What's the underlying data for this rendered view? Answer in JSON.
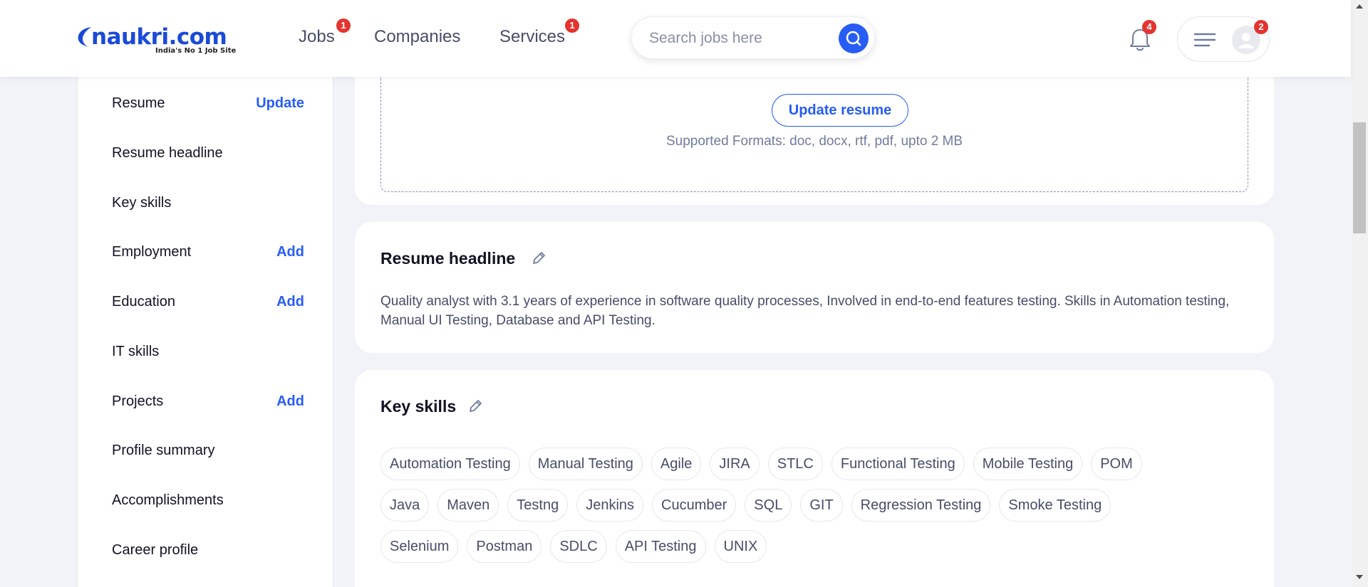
{
  "header": {
    "logo_text": "naukri",
    "logo_com": ".com",
    "logo_tagline": "India's No 1 Job Site",
    "nav": [
      {
        "label": "Jobs",
        "badge": "1"
      },
      {
        "label": "Companies"
      },
      {
        "label": "Services",
        "badge": "1"
      }
    ],
    "search_placeholder": "Search jobs here",
    "notifications_badge": "4",
    "profile_badge": "2"
  },
  "sidebar": {
    "items": [
      {
        "label": "Resume",
        "action": "Update"
      },
      {
        "label": "Resume headline"
      },
      {
        "label": "Key skills"
      },
      {
        "label": "Employment",
        "action": "Add"
      },
      {
        "label": "Education",
        "action": "Add"
      },
      {
        "label": "IT skills"
      },
      {
        "label": "Projects",
        "action": "Add"
      },
      {
        "label": "Profile summary"
      },
      {
        "label": "Accomplishments"
      },
      {
        "label": "Career profile"
      }
    ]
  },
  "resume_card": {
    "update_button": "Update resume",
    "formats": "Supported Formats: doc, docx, rtf, pdf, upto 2 MB"
  },
  "headline_card": {
    "title": "Resume headline",
    "text": "Quality analyst with 3.1 years of experience in software quality processes, Involved in end-to-end features testing. Skills in Automation testing, Manual UI Testing, Database and API Testing."
  },
  "skills_card": {
    "title": "Key skills",
    "rows": [
      [
        "Automation Testing",
        "Manual Testing",
        "Agile",
        "JIRA",
        "STLC",
        "Functional Testing",
        "Mobile Testing",
        "POM"
      ],
      [
        "Java",
        "Maven",
        "Testng",
        "Jenkins",
        "Cucumber",
        "SQL",
        "GIT",
        "Regression Testing",
        "Smoke Testing"
      ],
      [
        "Selenium",
        "Postman",
        "SDLC",
        "API Testing",
        "UNIX"
      ]
    ]
  },
  "colors": {
    "brand": "#275df5",
    "badge": "#e4342f",
    "text": "#121224",
    "muted": "#474d6a"
  }
}
